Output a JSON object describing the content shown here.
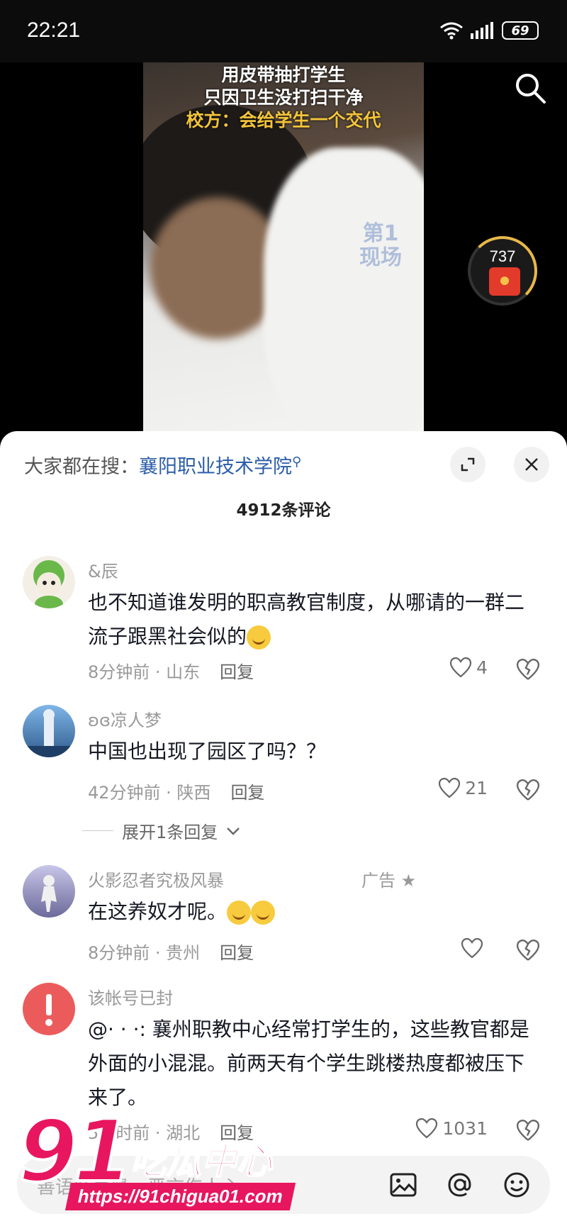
{
  "status_bar": {
    "time": "22:21",
    "battery": "69"
  },
  "video": {
    "caption_line1": "用皮带抽打学生",
    "caption_line2": "只因卫生没打扫干净",
    "caption_line3": "校方：会给学生一个交代",
    "watermark": "第1现场",
    "reward_count": "737"
  },
  "comments_panel": {
    "hot_search_label": "大家都在搜：",
    "hot_search_keyword": "襄阳职业技术学院",
    "count_label": "4912条评论"
  },
  "comments": [
    {
      "user": "&辰",
      "text": "也不知道谁发明的职高教官制度，从哪请的一群二流子跟黑社会似的",
      "time": "8分钟前 · 山东",
      "reply": "回复",
      "likes": "4"
    },
    {
      "user": "ʚɞ凉人梦",
      "text": "中国也出现了园区了吗？？",
      "time": "42分钟前 · 陕西",
      "reply": "回复",
      "likes": "21",
      "expand": "展开1条回复"
    },
    {
      "user": "火影忍者究极风暴",
      "ad": "广告 ★",
      "text": "在这养奴才呢。",
      "time": "8分钟前 · 贵州",
      "reply": "回复",
      "likes": ""
    },
    {
      "user": "该帐号已封",
      "text": "@· · ·: 襄州职教中心经常打学生的，这些教官都是外面的小混混。前两天有个学生跳楼热度都被压下来了。",
      "time": "5小时前 · 湖北",
      "reply": "回复",
      "likes": "1031"
    }
  ],
  "input_bar": {
    "placeholder": "善语结善缘，恶言伤人心"
  },
  "site_watermark": {
    "brand": "91",
    "name": "吃瓜中心",
    "url": "https://91chigua01.com"
  },
  "colors": {
    "accent_link": "#2a5caa",
    "brand_pink": "#e8165e",
    "caption_yellow": "#f3c43a"
  }
}
